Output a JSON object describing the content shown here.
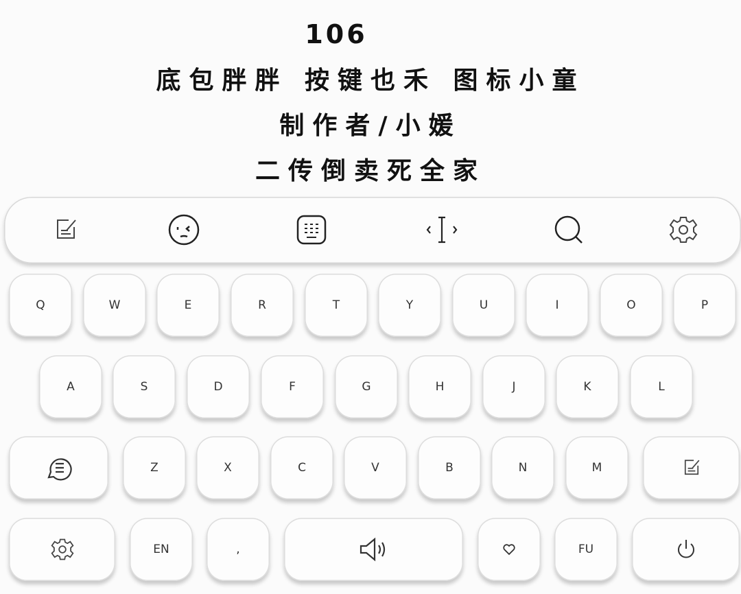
{
  "header": {
    "number": "106",
    "line1": "底包胖胖 按键也禾 图标小童",
    "line2": "制作者/小媛",
    "line3": "二传倒卖死全家"
  },
  "toolbar": {
    "icons": [
      "edit-icon",
      "emoji-icon",
      "keyboard-icon",
      "cursor-icon",
      "search-icon",
      "settings-icon"
    ]
  },
  "keyboard": {
    "row1": [
      "Q",
      "W",
      "E",
      "R",
      "T",
      "Y",
      "U",
      "I",
      "O",
      "P"
    ],
    "row2": [
      "A",
      "S",
      "D",
      "F",
      "G",
      "H",
      "J",
      "K",
      "L"
    ],
    "row3": [
      "Z",
      "X",
      "C",
      "V",
      "B",
      "N",
      "M"
    ],
    "row4": {
      "en": "EN",
      "comma": ",",
      "fu": "FU"
    }
  }
}
